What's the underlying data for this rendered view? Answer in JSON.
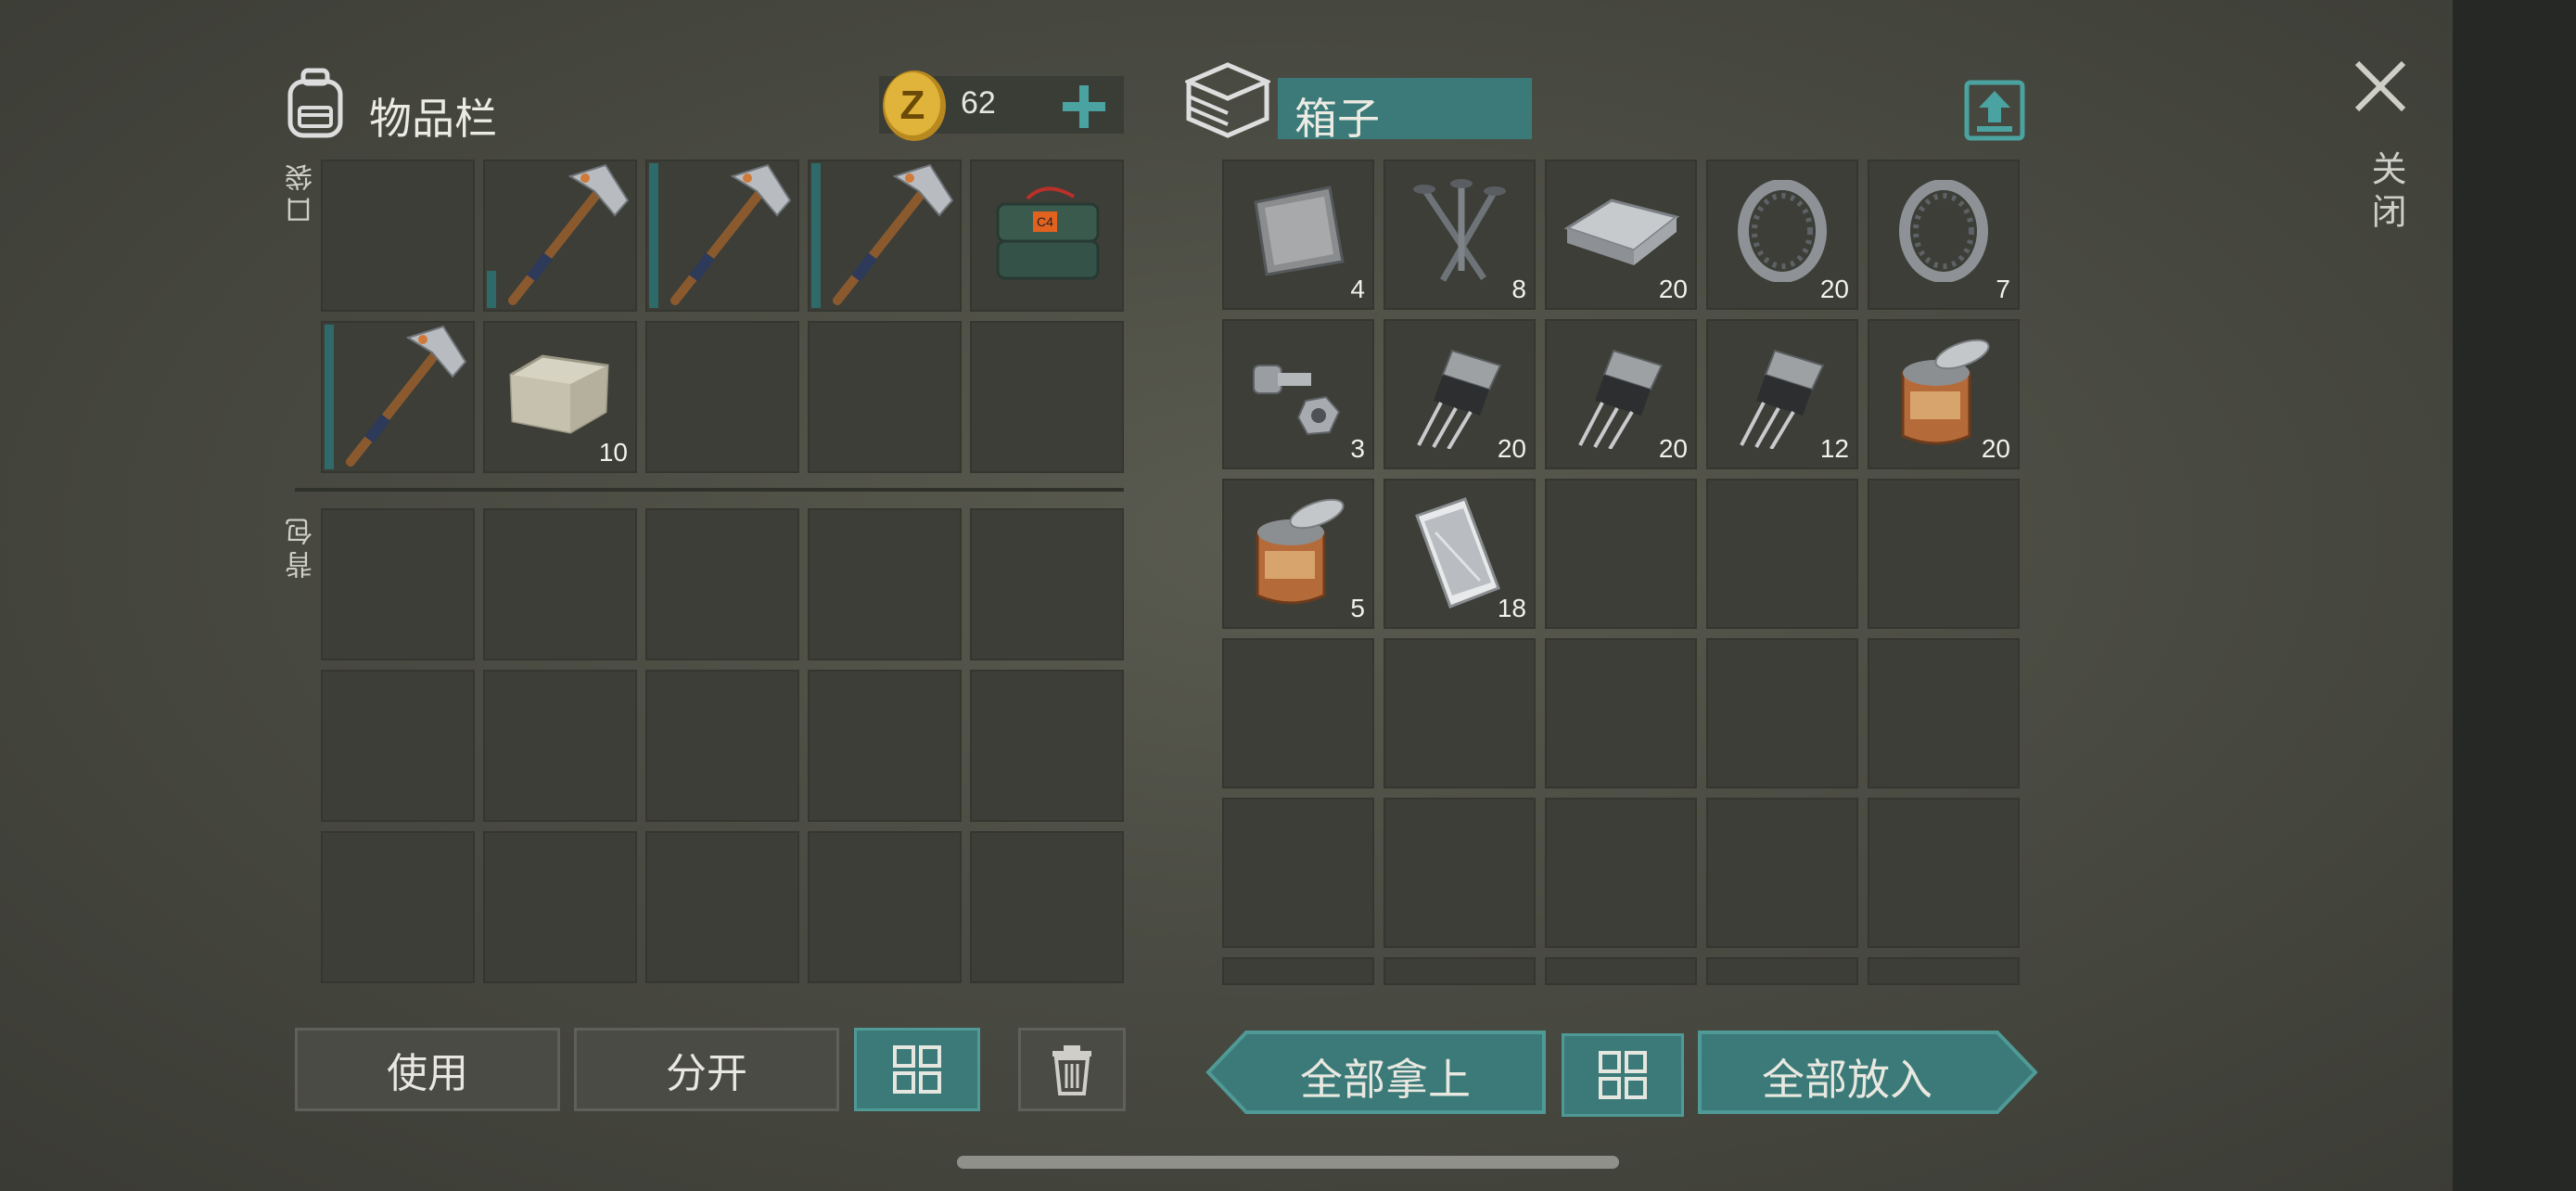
{
  "inventory": {
    "title": "物品栏",
    "coins": "62",
    "pocket_label": "口袋",
    "backpack_label": "背包",
    "pocket_slots": [
      {
        "item": "",
        "icon": "empty",
        "count": "",
        "durability": 0
      },
      {
        "item": "hammer",
        "icon": "hammer-icon",
        "count": "",
        "durability": 0.25
      },
      {
        "item": "hammer",
        "icon": "hammer-icon",
        "count": "",
        "durability": 1
      },
      {
        "item": "hammer",
        "icon": "hammer-icon",
        "count": "",
        "durability": 1
      },
      {
        "item": "c4",
        "icon": "explosive-icon",
        "count": "",
        "durability": 0
      },
      {
        "item": "hammer",
        "icon": "hammer-icon",
        "count": "",
        "durability": 1
      },
      {
        "item": "stone",
        "icon": "stone-block-icon",
        "count": "10",
        "durability": 0
      },
      {
        "item": "",
        "icon": "empty",
        "count": "",
        "durability": 0
      },
      {
        "item": "",
        "icon": "empty",
        "count": "",
        "durability": 0
      },
      {
        "item": "",
        "icon": "empty",
        "count": "",
        "durability": 0
      }
    ]
  },
  "box": {
    "title": "箱子",
    "slots": [
      {
        "icon": "metal-plate-icon",
        "count": "4"
      },
      {
        "icon": "nails-icon",
        "count": "8"
      },
      {
        "icon": "iron-ingot-icon",
        "count": "20"
      },
      {
        "icon": "bearing-icon",
        "count": "20"
      },
      {
        "icon": "bearing-icon",
        "count": "7"
      },
      {
        "icon": "bolt-nut-icon",
        "count": "3"
      },
      {
        "icon": "transistor-icon",
        "count": "20"
      },
      {
        "icon": "transistor-icon",
        "count": "20"
      },
      {
        "icon": "transistor-icon",
        "count": "12"
      },
      {
        "icon": "tin-can-icon",
        "count": "20"
      },
      {
        "icon": "tin-can-icon",
        "count": "5"
      },
      {
        "icon": "smartphone-icon",
        "count": "18"
      }
    ]
  },
  "buttons": {
    "use": "使用",
    "split": "分开",
    "take_all": "全部拿上",
    "put_all": "全部放入",
    "close": "关闭"
  },
  "colors": {
    "teal": "#3b7a78",
    "slot": "#3c3e37",
    "coin": "#e0b43a"
  }
}
